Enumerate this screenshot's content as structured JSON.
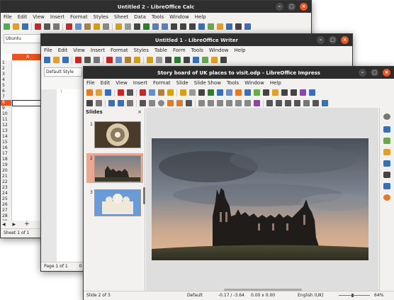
{
  "calc": {
    "title": "Untitled 2 - LibreOffice Calc",
    "menus": [
      "File",
      "Edit",
      "View",
      "Insert",
      "Format",
      "Styles",
      "Sheet",
      "Data",
      "Tools",
      "Window",
      "Help"
    ],
    "font_box": "Ubuntu",
    "column_a": "A",
    "rows": [
      "1",
      "2",
      "3",
      "4",
      "5",
      "6",
      "7",
      "8",
      "9",
      "10",
      "11",
      "12",
      "13",
      "14",
      "15",
      "16",
      "17",
      "18",
      "19",
      "20",
      "21",
      "22",
      "23",
      "24",
      "25",
      "26",
      "27",
      "28",
      "29"
    ],
    "status": "Sheet 1 of 1",
    "close": "×",
    "minimize": "–",
    "maximize": "□"
  },
  "writer": {
    "title": "Untitled 1 - LibreOffice Writer",
    "menus": [
      "File",
      "Edit",
      "View",
      "Insert",
      "Format",
      "Styles",
      "Table",
      "Form",
      "Tools",
      "Window",
      "Help"
    ],
    "style_box": "Default Style",
    "status": "Page 1 of 1",
    "status_extra": "0 w",
    "close": "×",
    "minimize": "–",
    "maximize": "□"
  },
  "impress": {
    "title": "Story board of UK places to visit.odp - LibreOffice Impress",
    "menus": [
      "File",
      "Edit",
      "View",
      "Insert",
      "Format",
      "Slide",
      "Slide Show",
      "Tools",
      "Window",
      "Help"
    ],
    "slides_title": "Slides",
    "slides_close": "×",
    "slide_numbers": [
      "1",
      "2",
      "3"
    ],
    "status_slide": "Slide 2 of 3",
    "status_style": "Default",
    "status_pos": "-0.17 / -3.64",
    "status_size": "0.00 x 0.00",
    "status_lang": "English (UK)",
    "status_zoom": "64%",
    "close": "×",
    "minimize": "–",
    "maximize": "□"
  }
}
